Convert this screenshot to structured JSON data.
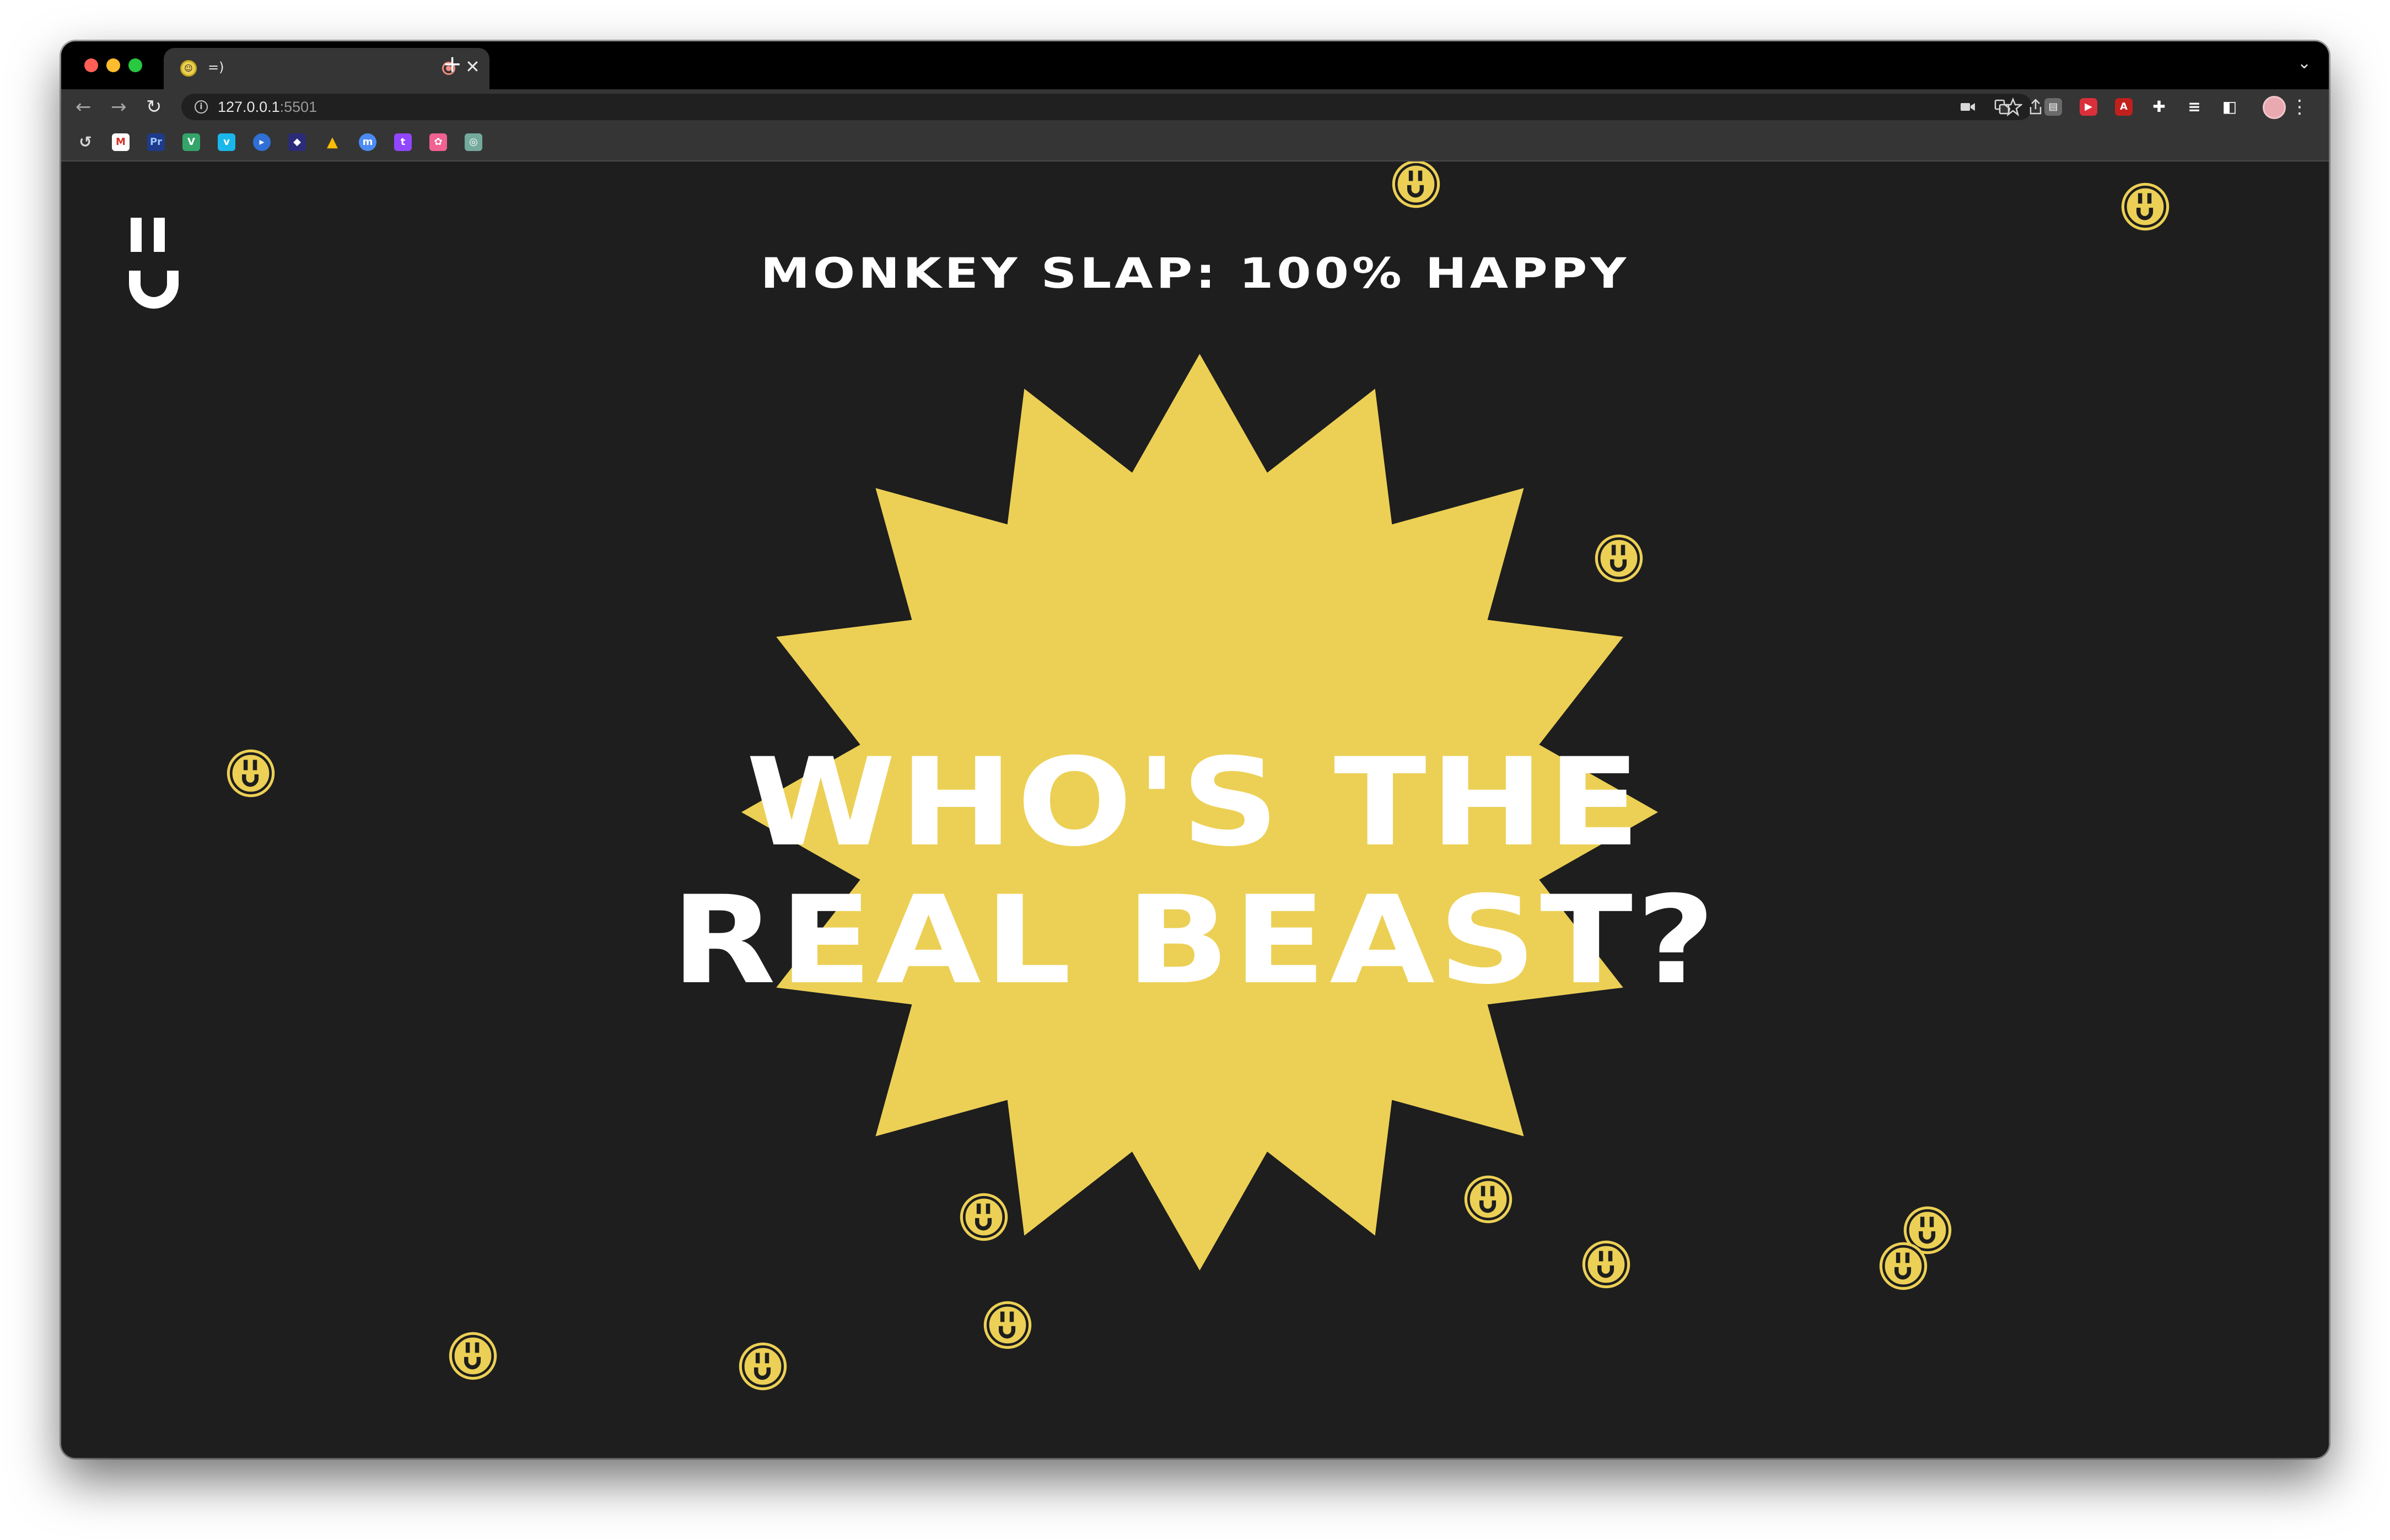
{
  "browser": {
    "tab": {
      "title": "=)",
      "favicon": "smiley-icon",
      "close_glyph": "✕"
    },
    "new_tab_glyph": "+",
    "tab_menu_glyph": "⌄",
    "url": {
      "host": "127.0.0.1",
      "port": ":5501"
    },
    "nav": {
      "back": "←",
      "forward": "→",
      "reload": "↻"
    },
    "omnibox_icons": [
      "video-camera-icon",
      "translate-icon",
      "share-icon",
      "star-icon"
    ],
    "extension_icons": [
      "cards-icon",
      "youtube-ext-icon",
      "pdf-icon",
      "puzzle-icon",
      "reading-list-icon",
      "side-panel-icon"
    ],
    "bookmark_icons": [
      "history-icon",
      "gmail-icon",
      "pr-icon",
      "vue-icon",
      "vimeo-icon",
      "play-icon",
      "nebula-icon",
      "drive-icon",
      "maps-icon",
      "twitch-icon",
      "flower-icon",
      "chatgpt-icon"
    ]
  },
  "page": {
    "headline": "MONKEY SLAP: 100% HAPPY",
    "hero_line1": "WHO'S THE",
    "hero_line2": "REAL BEAST?",
    "logo": "smiley-logo-icon",
    "decor": "coin-smiley-icon"
  },
  "colors": {
    "page_bg": "#1e1e1e",
    "accent_yellow": "#ecd055",
    "text_white": "#ffffff",
    "chrome_dark": "#000000",
    "chrome_toolbar": "#353535"
  }
}
